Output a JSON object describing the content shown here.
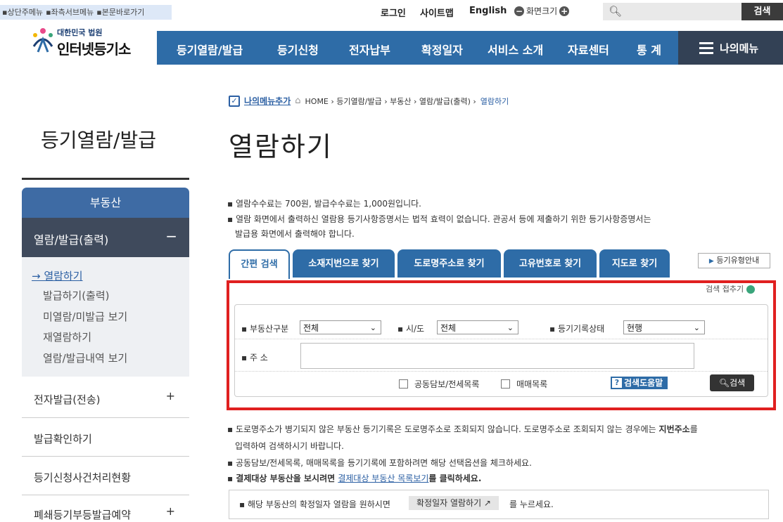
{
  "topbar": {
    "skip_links": [
      "▪상단주메뉴",
      "▪좌측서브메뉴",
      "▪본문바로가기"
    ],
    "login": "로그인",
    "sitemap": "사이트맵",
    "english": "English",
    "zoom_label": "화면크기",
    "zoom_out": "−",
    "zoom_in": "+",
    "search_placeholder": "",
    "search_button": "검색"
  },
  "logo": {
    "sub": "대한민국 법원",
    "main": "인터넷등기소"
  },
  "gnb": [
    "등기열람/발급",
    "등기신청",
    "전자납부",
    "확정일자",
    "서비스 소개",
    "자료센터",
    "통 계"
  ],
  "my_menu": "나의메뉴",
  "breadcrumb": {
    "add": "나의메뉴추가",
    "path": "HOME › 등기열람/발급 › 부동산 › 열람/발급(출력) ›",
    "current": "열람하기"
  },
  "page_title": "열람하기",
  "sidebar": {
    "title": "등기열람/발급",
    "category": "부동산",
    "active_group": "열람/발급(출력)",
    "sub_items": [
      "→ 열람하기",
      "발급하기(출력)",
      "미열람/미발급 보기",
      "재열람하기",
      "열람/발급내역 보기"
    ],
    "groups": [
      "전자발급(전송)",
      "발급확인하기",
      "등기신청사건처리현황",
      "폐쇄등기부등발급예약"
    ]
  },
  "notices_top": [
    "▪ 열람수수료는 700원, 발급수수료는 1,000원입니다.",
    "▪ 열람 화면에서 출력하신 열람용 등기사항증명서는 법적 효력이 없습니다. 관공서 등에 제출하기 위한 등기사항증명서는",
    "발급용 화면에서 출력해야 합니다."
  ],
  "tabs": [
    "간편 검색",
    "소재지번으로 찾기",
    "도로명주소로 찾기",
    "고유번호로 찾기",
    "지도로 찾기"
  ],
  "type_guide": "등기유형안내",
  "search": {
    "fold": "검색 접추기",
    "type_label": "▪ 부동산구분",
    "type_value": "전체",
    "city_label": "▪ 시/도",
    "city_value": "전체",
    "status_label": "▪ 등기기록상태",
    "status_value": "현행",
    "addr_label": "▪ 주 소",
    "addr_value": "",
    "chk_joint": "공동담보/전세목록",
    "chk_trade": "매매목록",
    "help": "검색도움말",
    "go": "검색"
  },
  "notices_bottom": {
    "l1a": "▪ 도로명주소가 병기되지 않은 부동산 등기기록은 도로명주소로 조회되지 않습니다. 도로명주소로 조회되지 않는 경우에는 ",
    "l1b": "지번주소",
    "l1c": "를",
    "l2": "입력하여 검색하시기 바랍니다.",
    "l3": "▪ 공동담보/전세목록, 매매목록을 등기기록에 포함하려면 해당 선택옵션을 체크하세요.",
    "l4a": "▪ 결제대상 부동산을 보시려면 ",
    "l4b": "결제대상 부동산 목록보기",
    "l4c": "를 클릭하세요."
  },
  "bottom_box": {
    "text": "▪ 해당 부동산의 확정일자 열람을 원하시면",
    "button": "확정일자 열람하기 ↗",
    "tail": "를 누르세요."
  },
  "colors": {
    "brand_blue": "#2e6ca7",
    "highlight_red": "#e02020",
    "nav_dark": "#334155"
  }
}
